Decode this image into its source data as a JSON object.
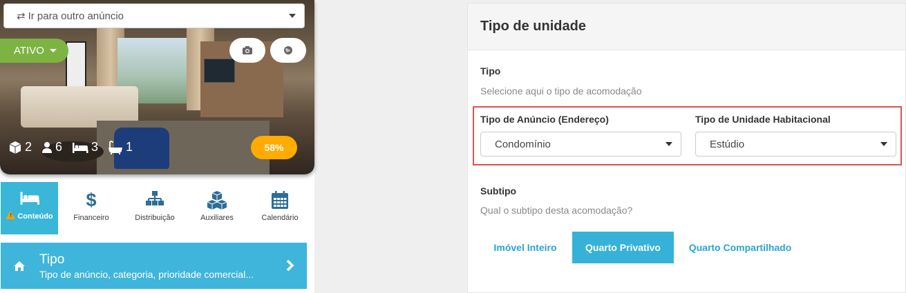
{
  "listing_switcher": {
    "label": "Ir para outro anúncio"
  },
  "status": {
    "label": "ATIVO"
  },
  "stats": {
    "units": "2",
    "guests": "6",
    "beds": "3",
    "baths": "1"
  },
  "completion": {
    "label": "58%"
  },
  "tabs": [
    {
      "label": "Conteúdo",
      "icon": "bed-icon"
    },
    {
      "label": "Financeiro",
      "icon": "dollar-icon"
    },
    {
      "label": "Distribuição",
      "icon": "sitemap-icon"
    },
    {
      "label": "Auxiliares",
      "icon": "cubes-icon"
    },
    {
      "label": "Calendário",
      "icon": "calendar-icon"
    }
  ],
  "section_card": {
    "title": "Tipo",
    "subtitle": "Tipo de anúncio, categoria, prioridade comercial..."
  },
  "panel": {
    "title": "Tipo de unidade",
    "tipo_label": "Tipo",
    "tipo_hint": "Selecione aqui o tipo de acomodação",
    "anuncio_label": "Tipo de Anúncio (Endereço)",
    "anuncio_value": "Condomínio",
    "unidade_label": "Tipo de Unidade Habitacional",
    "unidade_value": "Estúdio",
    "subtipo_label": "Subtipo",
    "subtipo_hint": "Qual o subtipo desta acomodação?",
    "subtipo_options": [
      "Imóvel Inteiro",
      "Quarto Privativo",
      "Quarto Compartilhado"
    ],
    "subtipo_selected": "Quarto Privativo"
  },
  "colors": {
    "accent": "#39b6d8",
    "status_green": "#7cb342",
    "progress_orange": "#ffab00",
    "highlight_red": "#d9534f"
  }
}
